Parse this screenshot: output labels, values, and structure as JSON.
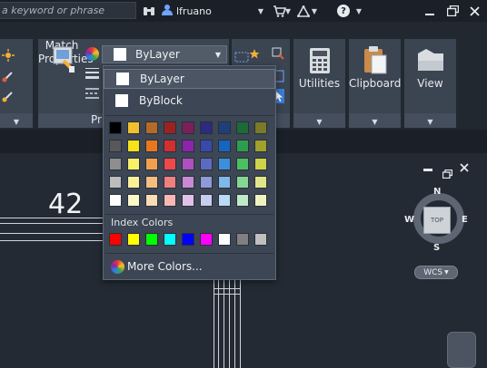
{
  "search": {
    "placeholder": "a keyword or phrase"
  },
  "user": {
    "name": "lfruano"
  },
  "ribbon": {
    "match_properties": {
      "line1": "Match",
      "line2": "Properties"
    },
    "properties_panel_label": "Pr",
    "color_combo": {
      "value": "ByLayer"
    },
    "utilities": "Utilities",
    "clipboard": "Clipboard",
    "view": "View"
  },
  "color_dropdown": {
    "bylayer": "ByLayer",
    "byblock": "ByBlock",
    "index_colors_label": "Index Colors",
    "more_colors": "More Colors...",
    "grid_colors": [
      [
        "#000000",
        "#f0c030",
        "#b56a2a",
        "#9c2222",
        "#7b1f5a",
        "#2b2b82",
        "#1f3f78",
        "#1a6b38",
        "#7a7a2a"
      ],
      [
        "#585858",
        "#f7e21c",
        "#e8781e",
        "#d32f2f",
        "#8e24aa",
        "#3949ab",
        "#1565c0",
        "#2e9e4e",
        "#a0a02c"
      ],
      [
        "#8e8e8e",
        "#f8ef6a",
        "#f2a04e",
        "#ef4848",
        "#b04fc0",
        "#5c6bc0",
        "#3b8fdc",
        "#4cbf62",
        "#cfd24a"
      ],
      [
        "#bdbdbd",
        "#faf09a",
        "#f5bd80",
        "#f07f7f",
        "#c98ad5",
        "#8f9ad8",
        "#7fb8ea",
        "#86d693",
        "#e2e48a"
      ],
      [
        "#ffffff",
        "#fdf7c8",
        "#f9dbb6",
        "#f7b7b7",
        "#e2bfe8",
        "#c7cdee",
        "#b9d9f5",
        "#bfe9c7",
        "#eff1c0"
      ]
    ],
    "index_colors": [
      "#ff0000",
      "#ffff00",
      "#00ff00",
      "#00ffff",
      "#0000ff",
      "#ff00ff",
      "#ffffff",
      "#808080",
      "#c0c0c0"
    ]
  },
  "drawing": {
    "dimension_text": "42"
  },
  "viewcube": {
    "top": "TOP",
    "north": "N",
    "south": "S",
    "east": "E",
    "west": "W",
    "wcs": "WCS"
  }
}
